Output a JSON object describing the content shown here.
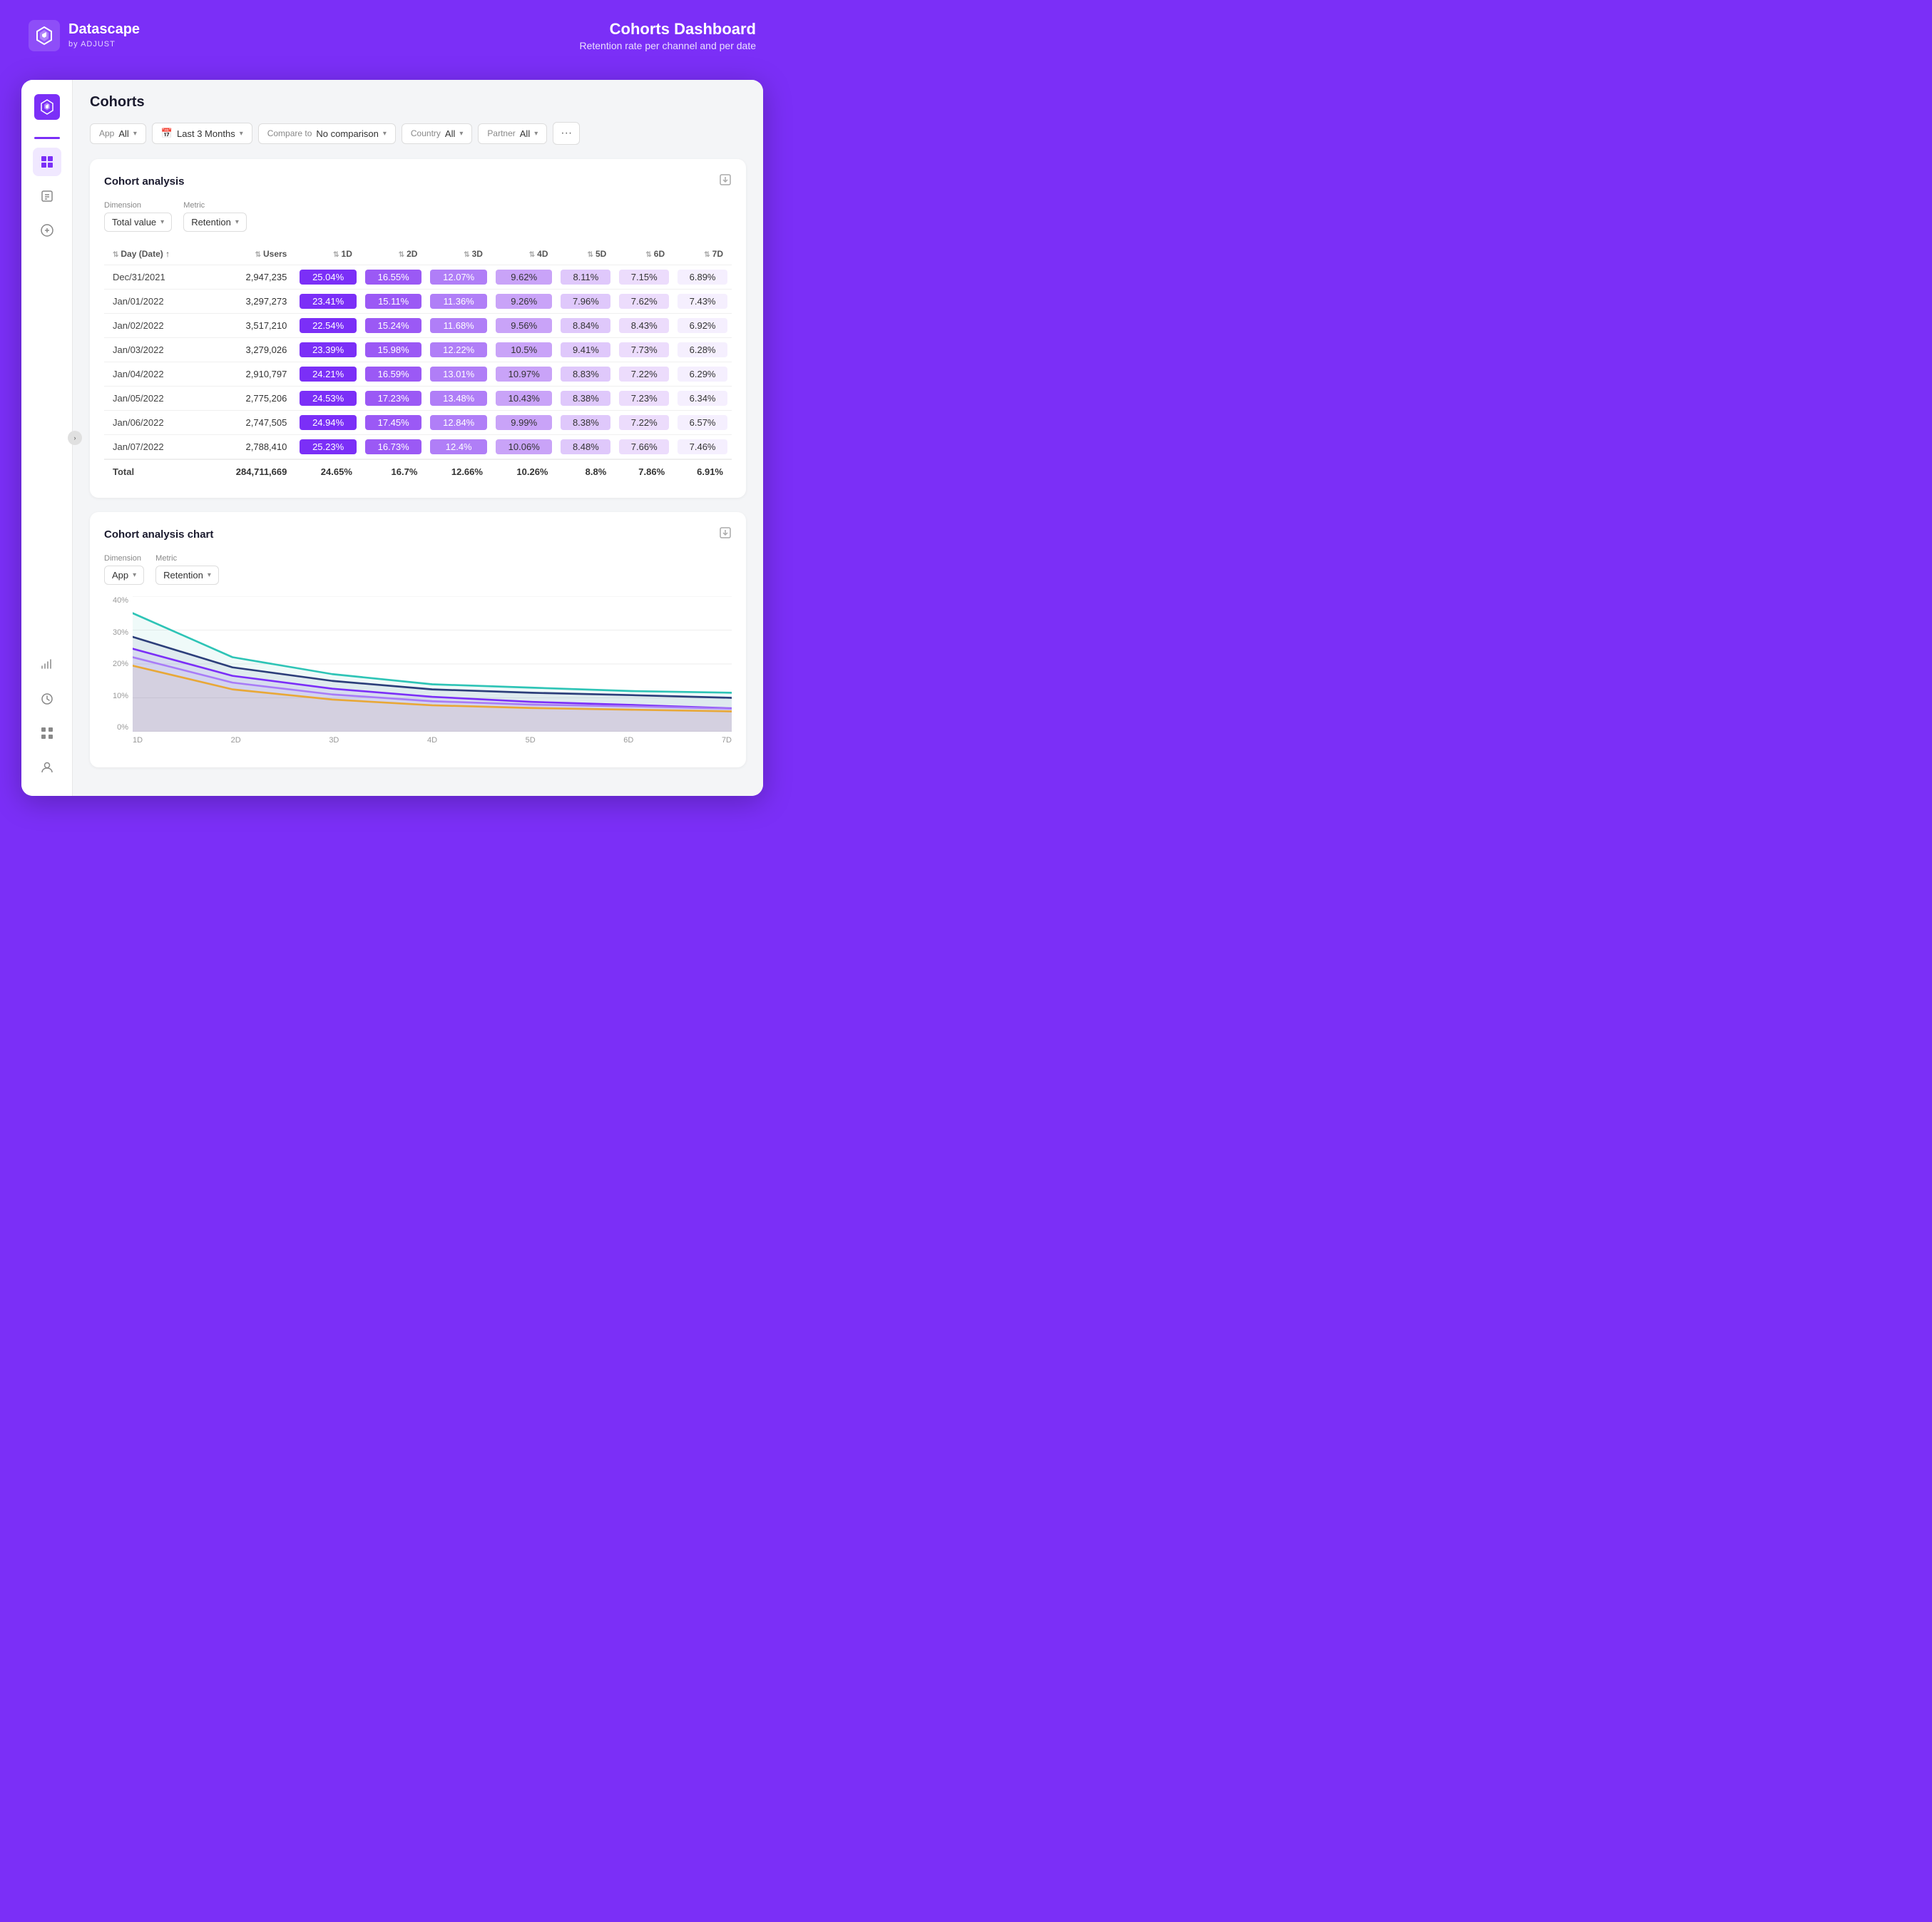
{
  "header": {
    "brand": "Datascape",
    "by": "by ADJUST",
    "title": "Cohorts Dashboard",
    "subtitle": "Retention rate per channel and per date"
  },
  "page": {
    "title": "Cohorts"
  },
  "filters": {
    "app_label": "App",
    "app_value": "All",
    "date_icon": "📅",
    "date_value": "Last 3 Months",
    "compare_label": "Compare to",
    "compare_value": "No comparison",
    "country_label": "Country",
    "country_value": "All",
    "partner_label": "Partner",
    "partner_value": "All",
    "more": "···"
  },
  "cohort_table": {
    "title": "Cohort analysis",
    "dimension_label": "Dimension",
    "dimension_value": "Total value",
    "metric_label": "Metric",
    "metric_value": "Retention",
    "columns": [
      "Day (Date)",
      "Users",
      "1D",
      "2D",
      "3D",
      "4D",
      "5D",
      "6D",
      "7D"
    ],
    "rows": [
      {
        "date": "Dec/31/2021",
        "users": "2,947,235",
        "d1": "25.04%",
        "d2": "16.55%",
        "d3": "12.07%",
        "d4": "9.62%",
        "d5": "8.11%",
        "d6": "7.15%",
        "d7": "6.89%"
      },
      {
        "date": "Jan/01/2022",
        "users": "3,297,273",
        "d1": "23.41%",
        "d2": "15.11%",
        "d3": "11.36%",
        "d4": "9.26%",
        "d5": "7.96%",
        "d6": "7.62%",
        "d7": "7.43%"
      },
      {
        "date": "Jan/02/2022",
        "users": "3,517,210",
        "d1": "22.54%",
        "d2": "15.24%",
        "d3": "11.68%",
        "d4": "9.56%",
        "d5": "8.84%",
        "d6": "8.43%",
        "d7": "6.92%"
      },
      {
        "date": "Jan/03/2022",
        "users": "3,279,026",
        "d1": "23.39%",
        "d2": "15.98%",
        "d3": "12.22%",
        "d4": "10.5%",
        "d5": "9.41%",
        "d6": "7.73%",
        "d7": "6.28%"
      },
      {
        "date": "Jan/04/2022",
        "users": "2,910,797",
        "d1": "24.21%",
        "d2": "16.59%",
        "d3": "13.01%",
        "d4": "10.97%",
        "d5": "8.83%",
        "d6": "7.22%",
        "d7": "6.29%"
      },
      {
        "date": "Jan/05/2022",
        "users": "2,775,206",
        "d1": "24.53%",
        "d2": "17.23%",
        "d3": "13.48%",
        "d4": "10.43%",
        "d5": "8.38%",
        "d6": "7.23%",
        "d7": "6.34%"
      },
      {
        "date": "Jan/06/2022",
        "users": "2,747,505",
        "d1": "24.94%",
        "d2": "17.45%",
        "d3": "12.84%",
        "d4": "9.99%",
        "d5": "8.38%",
        "d6": "7.22%",
        "d7": "6.57%"
      },
      {
        "date": "Jan/07/2022",
        "users": "2,788,410",
        "d1": "25.23%",
        "d2": "16.73%",
        "d3": "12.4%",
        "d4": "10.06%",
        "d5": "8.48%",
        "d6": "7.66%",
        "d7": "7.46%"
      }
    ],
    "total": {
      "label": "Total",
      "users": "284,711,669",
      "d1": "24.65%",
      "d2": "16.7%",
      "d3": "12.66%",
      "d4": "10.26%",
      "d5": "8.8%",
      "d6": "7.86%",
      "d7": "6.91%"
    }
  },
  "chart": {
    "title": "Cohort analysis chart",
    "dimension_label": "Dimension",
    "dimension_value": "App",
    "metric_label": "Metric",
    "metric_value": "Retention",
    "y_labels": [
      "40%",
      "30%",
      "20%",
      "10%",
      "0%"
    ],
    "x_labels": [
      "1D",
      "2D",
      "3D",
      "4D",
      "5D",
      "6D",
      "7D"
    ],
    "lines": [
      {
        "color": "#2ec4b6",
        "points": [
          0.35,
          0.22,
          0.17,
          0.14,
          0.13,
          0.12,
          0.115
        ]
      },
      {
        "color": "#2c3e7a",
        "points": [
          0.28,
          0.19,
          0.15,
          0.125,
          0.115,
          0.108,
          0.1
        ]
      },
      {
        "color": "#7b2ff7",
        "points": [
          0.245,
          0.165,
          0.127,
          0.103,
          0.088,
          0.079,
          0.069
        ]
      },
      {
        "color": "#a87cf7",
        "points": [
          0.22,
          0.145,
          0.11,
          0.09,
          0.08,
          0.075,
          0.068
        ]
      },
      {
        "color": "#e8a838",
        "points": [
          0.195,
          0.125,
          0.095,
          0.078,
          0.07,
          0.065,
          0.06
        ]
      }
    ]
  },
  "sidebar": {
    "items": [
      {
        "name": "home",
        "icon": "home"
      },
      {
        "name": "chart",
        "icon": "chart"
      },
      {
        "name": "table",
        "icon": "table"
      },
      {
        "name": "game",
        "icon": "game"
      }
    ],
    "bottom_items": [
      {
        "name": "signal",
        "icon": "signal"
      },
      {
        "name": "clock",
        "icon": "clock"
      },
      {
        "name": "grid",
        "icon": "grid"
      },
      {
        "name": "user",
        "icon": "user"
      }
    ]
  }
}
